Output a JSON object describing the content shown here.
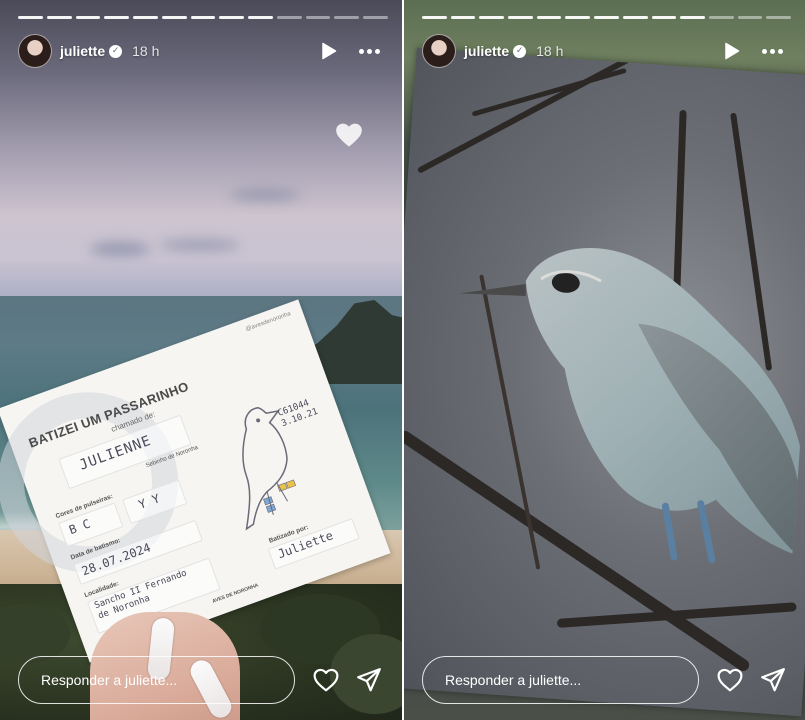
{
  "stories": [
    {
      "id": "left",
      "progress": {
        "segments": 13,
        "completed": 9
      },
      "header": {
        "username": "juliette",
        "time": "18 h",
        "verified": true
      },
      "card": {
        "handle": "@avesdenoronha",
        "title": "BATIZEI UM PASSARINHO",
        "subtitle": "chamado de:",
        "name_written": "JULIENNE",
        "species": "Sebinho de Noronha",
        "ring_label": "Cores de pulseiras:",
        "ring_codes_left": "B  C",
        "ring_codes_right": "Y  Y",
        "date_label": "Data de batismo:",
        "date_written": "28.07.2024",
        "location_label": "Localidade:",
        "location_written": "Sancho II  Fernando de Noronha",
        "signed_label": "Batizado por:",
        "signed_written": "Juliette",
        "bird_code": "C61044  3.10.21",
        "footer_logo": "AVES DE NORONHA"
      },
      "footer": {
        "reply_placeholder": "Responder a juliette..."
      }
    },
    {
      "id": "right",
      "progress": {
        "segments": 13,
        "completed": 10
      },
      "header": {
        "username": "juliette",
        "time": "18 h",
        "verified": true
      },
      "footer": {
        "reply_placeholder": "Responder a juliette..."
      }
    }
  ],
  "icons": {
    "play": "play-icon",
    "more": "more-options-icon",
    "heart": "heart-icon",
    "send": "send-icon",
    "verified": "verified-badge-icon",
    "liked_heart": "heart-filled-icon"
  },
  "colors": {
    "ui_white": "#ffffff",
    "verified_mark": "#6a6f7a"
  }
}
